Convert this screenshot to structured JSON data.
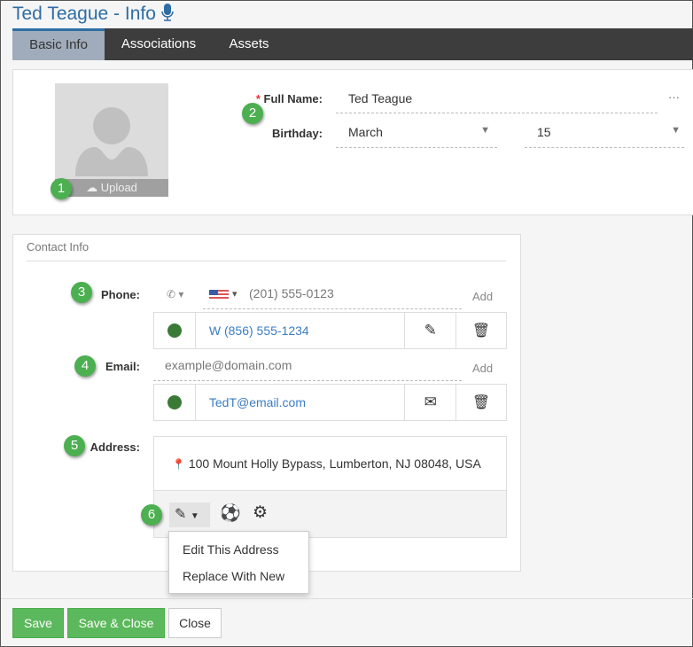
{
  "header": {
    "title": "Ted Teague - Info",
    "mic_icon": "microphone-icon"
  },
  "tabs": [
    {
      "label": "Basic Info",
      "active": true
    },
    {
      "label": "Associations"
    },
    {
      "label": "Assets"
    }
  ],
  "basic": {
    "upload_label": "Upload",
    "full_name_label": "Full Name:",
    "full_name_value": "Ted Teague",
    "more": "···",
    "birthday_label": "Birthday:",
    "birthday_month": "March",
    "birthday_day": "15"
  },
  "contact": {
    "title": "Contact Info",
    "phone_label": "Phone:",
    "phone_placeholder": "(201) 555-0123",
    "add": "Add",
    "phones": [
      {
        "value": "W (856) 555-1234"
      }
    ],
    "email_label": "Email:",
    "email_placeholder": "example@domain.com",
    "emails": [
      {
        "value": "TedT@email.com"
      }
    ],
    "address_label": "Address:",
    "address": "100 Mount Holly Bypass, Lumberton, NJ 08048, USA",
    "menu": [
      "Edit This Address",
      "Replace With New"
    ]
  },
  "badges": [
    "1",
    "2",
    "3",
    "4",
    "5",
    "6"
  ],
  "footer": {
    "save": "Save",
    "save_close": "Save & Close",
    "close": "Close"
  },
  "colors": {
    "accent": "#2e6da4",
    "success": "#5cb85c",
    "status_dot": "#3a7a37",
    "badge": "#4caf50"
  }
}
